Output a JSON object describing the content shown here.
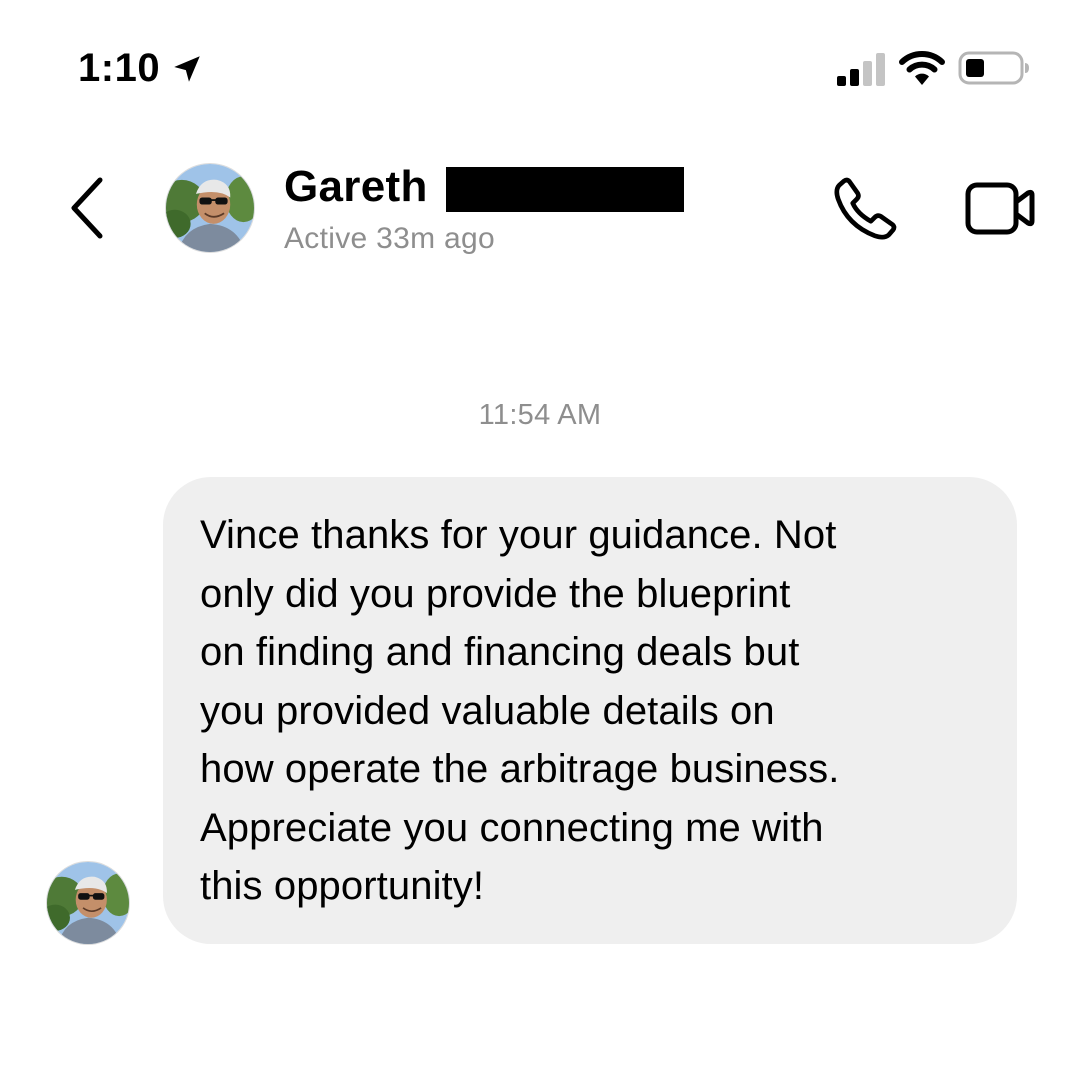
{
  "status_bar": {
    "time": "1:10",
    "icons": [
      "location-arrow-icon",
      "cellular-signal-icon",
      "wifi-icon",
      "battery-icon"
    ]
  },
  "header": {
    "back_icon": "chevron-left-icon",
    "contact_name": "Gareth",
    "active_status": "Active 33m ago",
    "actions": [
      {
        "icon": "phone-icon"
      },
      {
        "icon": "video-camera-icon"
      }
    ]
  },
  "conversation": {
    "timestamp": "11:54 AM",
    "messages": [
      {
        "lines": [
          "Vince thanks for your guidance. Not",
          "only did you provide the blueprint",
          "on finding and financing deals but",
          "you provided valuable details on",
          "how operate the arbitrage business.",
          "Appreciate you connecting me with",
          "this opportunity!"
        ]
      }
    ]
  },
  "colors": {
    "background": "#ffffff",
    "bubble": "#efefef",
    "secondary_text": "#8e8e8e",
    "primary_text": "#000000"
  }
}
